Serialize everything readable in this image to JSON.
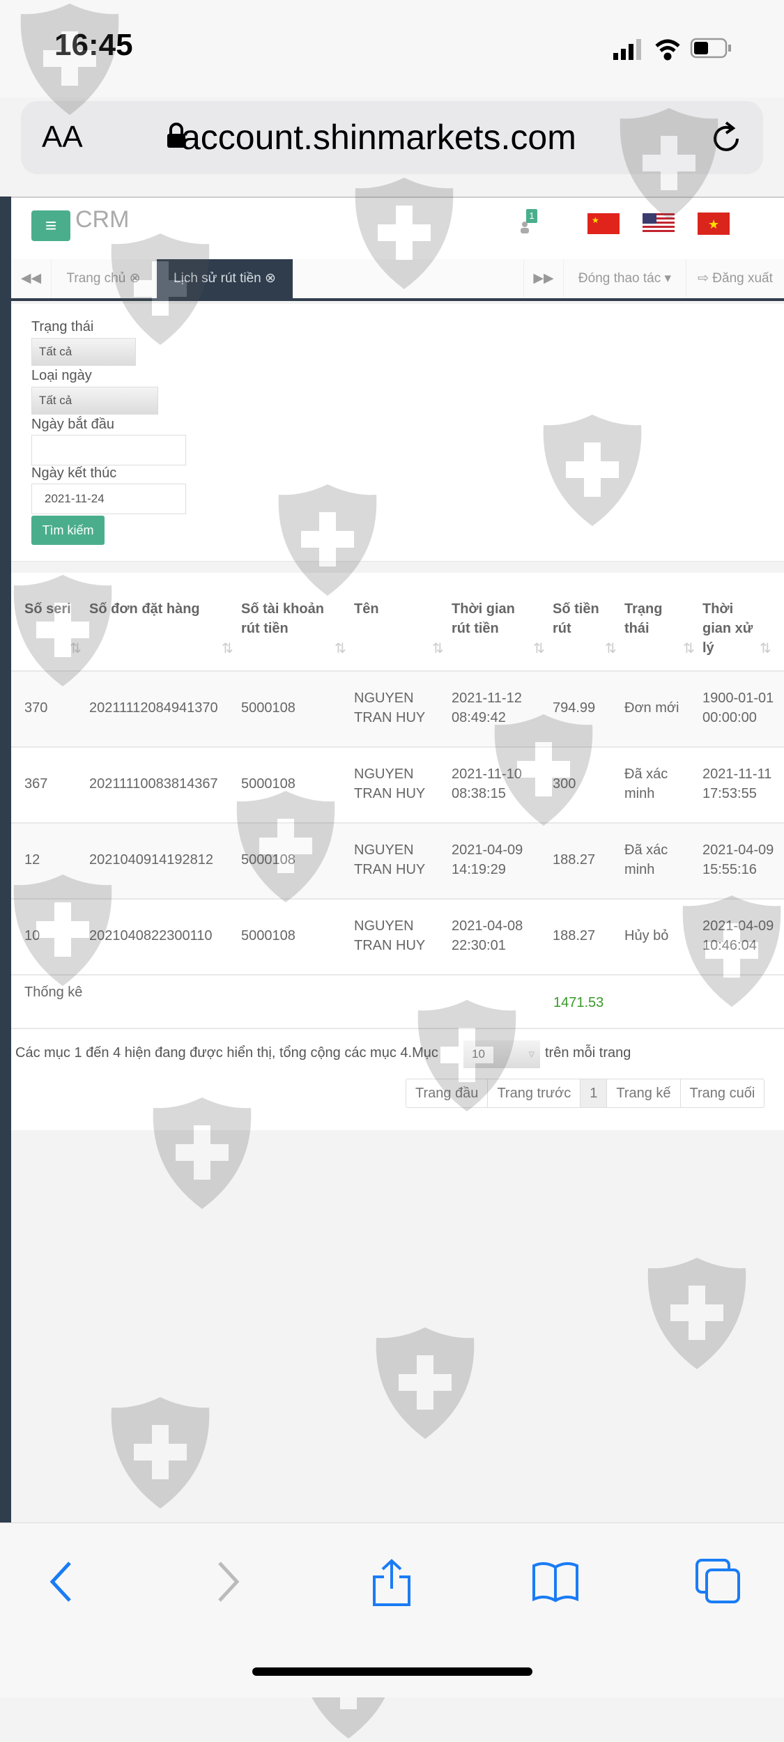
{
  "status_bar": {
    "time": "16:45"
  },
  "browser": {
    "text_size": "AA",
    "url": "account.shinmarkets.com"
  },
  "header": {
    "app_name": "CRM",
    "notification_count": "1"
  },
  "tabs": {
    "home": "Trang chủ",
    "current": "Lịch sử rút tiền",
    "actions": "Đóng thao tác",
    "logout": "Đăng xuất"
  },
  "form": {
    "status_label": "Trạng thái",
    "status_value": "Tất cả",
    "date_type_label": "Loại ngày",
    "date_type_value": "Tất cả",
    "start_label": "Ngày bắt đầu",
    "start_value": "",
    "end_label": "Ngày kết thúc",
    "end_value": "2021-11-24",
    "search_button": "Tìm kiếm"
  },
  "table": {
    "headers": [
      "Số seri",
      "Số đơn đặt hàng",
      "Số tài khoản rút tiền",
      "Tên",
      "Thời gian rút tiền",
      "Số tiền rút",
      "Trạng thái",
      "Thời gian xử lý"
    ],
    "rows": [
      [
        "370",
        "20211112084941370",
        "5000108",
        "NGUYEN TRAN HUY",
        "2021-11-12 08:49:42",
        "794.99",
        "Đơn mới",
        "1900-01-01 00:00:00"
      ],
      [
        "367",
        "20211110083814367",
        "5000108",
        "NGUYEN TRAN HUY",
        "2021-11-10 08:38:15",
        "300",
        "Đã xác minh",
        "2021-11-11 17:53:55"
      ],
      [
        "12",
        "2021040914192812",
        "5000108",
        "NGUYEN TRAN HUY",
        "2021-04-09 14:19:29",
        "188.27",
        "Đã xác minh",
        "2021-04-09 15:55:16"
      ],
      [
        "10",
        "2021040822300110",
        "5000108",
        "NGUYEN TRAN HUY",
        "2021-04-08 22:30:01",
        "188.27",
        "Hủy bỏ",
        "2021-04-09 10:46:04"
      ]
    ],
    "summary_label": "Thống kê",
    "summary_total": "1471.53"
  },
  "footer": {
    "info": "Các mục 1 đến 4 hiện đang được hiển thị, tổng cộng các mục 4.Mục",
    "per_page": "10",
    "per_page_suffix": "trên mỗi trang",
    "pager": [
      "Trang đầu",
      "Trang trước",
      "1",
      "Trang kế",
      "Trang cuối"
    ]
  },
  "colors": {
    "accent": "#4aae8c",
    "sidebar": "#2f3d4d",
    "total": "#3a9a2a",
    "ios_blue": "#1a7cf5"
  }
}
